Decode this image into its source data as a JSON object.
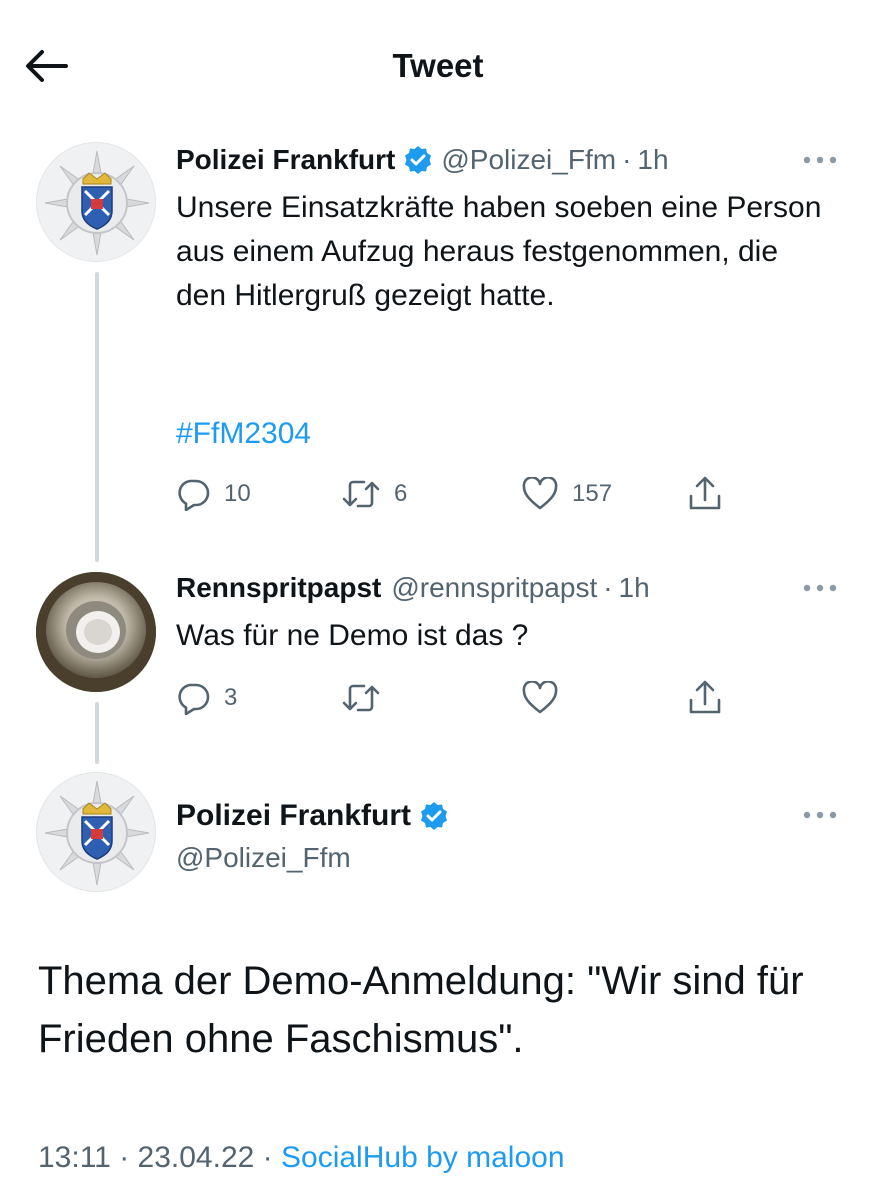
{
  "header": {
    "title": "Tweet"
  },
  "tweets": [
    {
      "name": "Polizei Frankfurt",
      "handle": "@Polizei_Ffm",
      "sep": "·",
      "time": "1h",
      "text": "Unsere Einsatzkräfte haben soeben eine Person aus einem Aufzug heraus festgenommen, die den Hitlergruß gezeigt hatte.",
      "hashtag": "#FfM2304",
      "replies": "10",
      "retweets": "6",
      "likes": "157"
    },
    {
      "name": "Rennspritpapst",
      "handle": "@rennspritpapst",
      "sep": "·",
      "time": "1h",
      "text": "Was für ne Demo ist das ?",
      "replies": "3",
      "retweets": "",
      "likes": ""
    }
  ],
  "focus": {
    "name": "Polizei Frankfurt",
    "handle": "@Polizei_Ffm",
    "text": "Thema der Demo-Anmeldung: \"Wir sind für Frieden ohne Faschismus\".",
    "time": "13:11",
    "sep1": "·",
    "date": "23.04.22",
    "sep2": "·",
    "source": "SocialHub by maloon"
  },
  "colors": {
    "accent": "#1d9bf0",
    "secondary": "#536471",
    "text": "#0f1419",
    "thread": "#cfd9de"
  },
  "icons": [
    "back-arrow-icon",
    "verified-badge-icon",
    "more-icon",
    "reply-icon",
    "retweet-icon",
    "like-icon",
    "share-icon",
    "police-star-icon"
  ]
}
